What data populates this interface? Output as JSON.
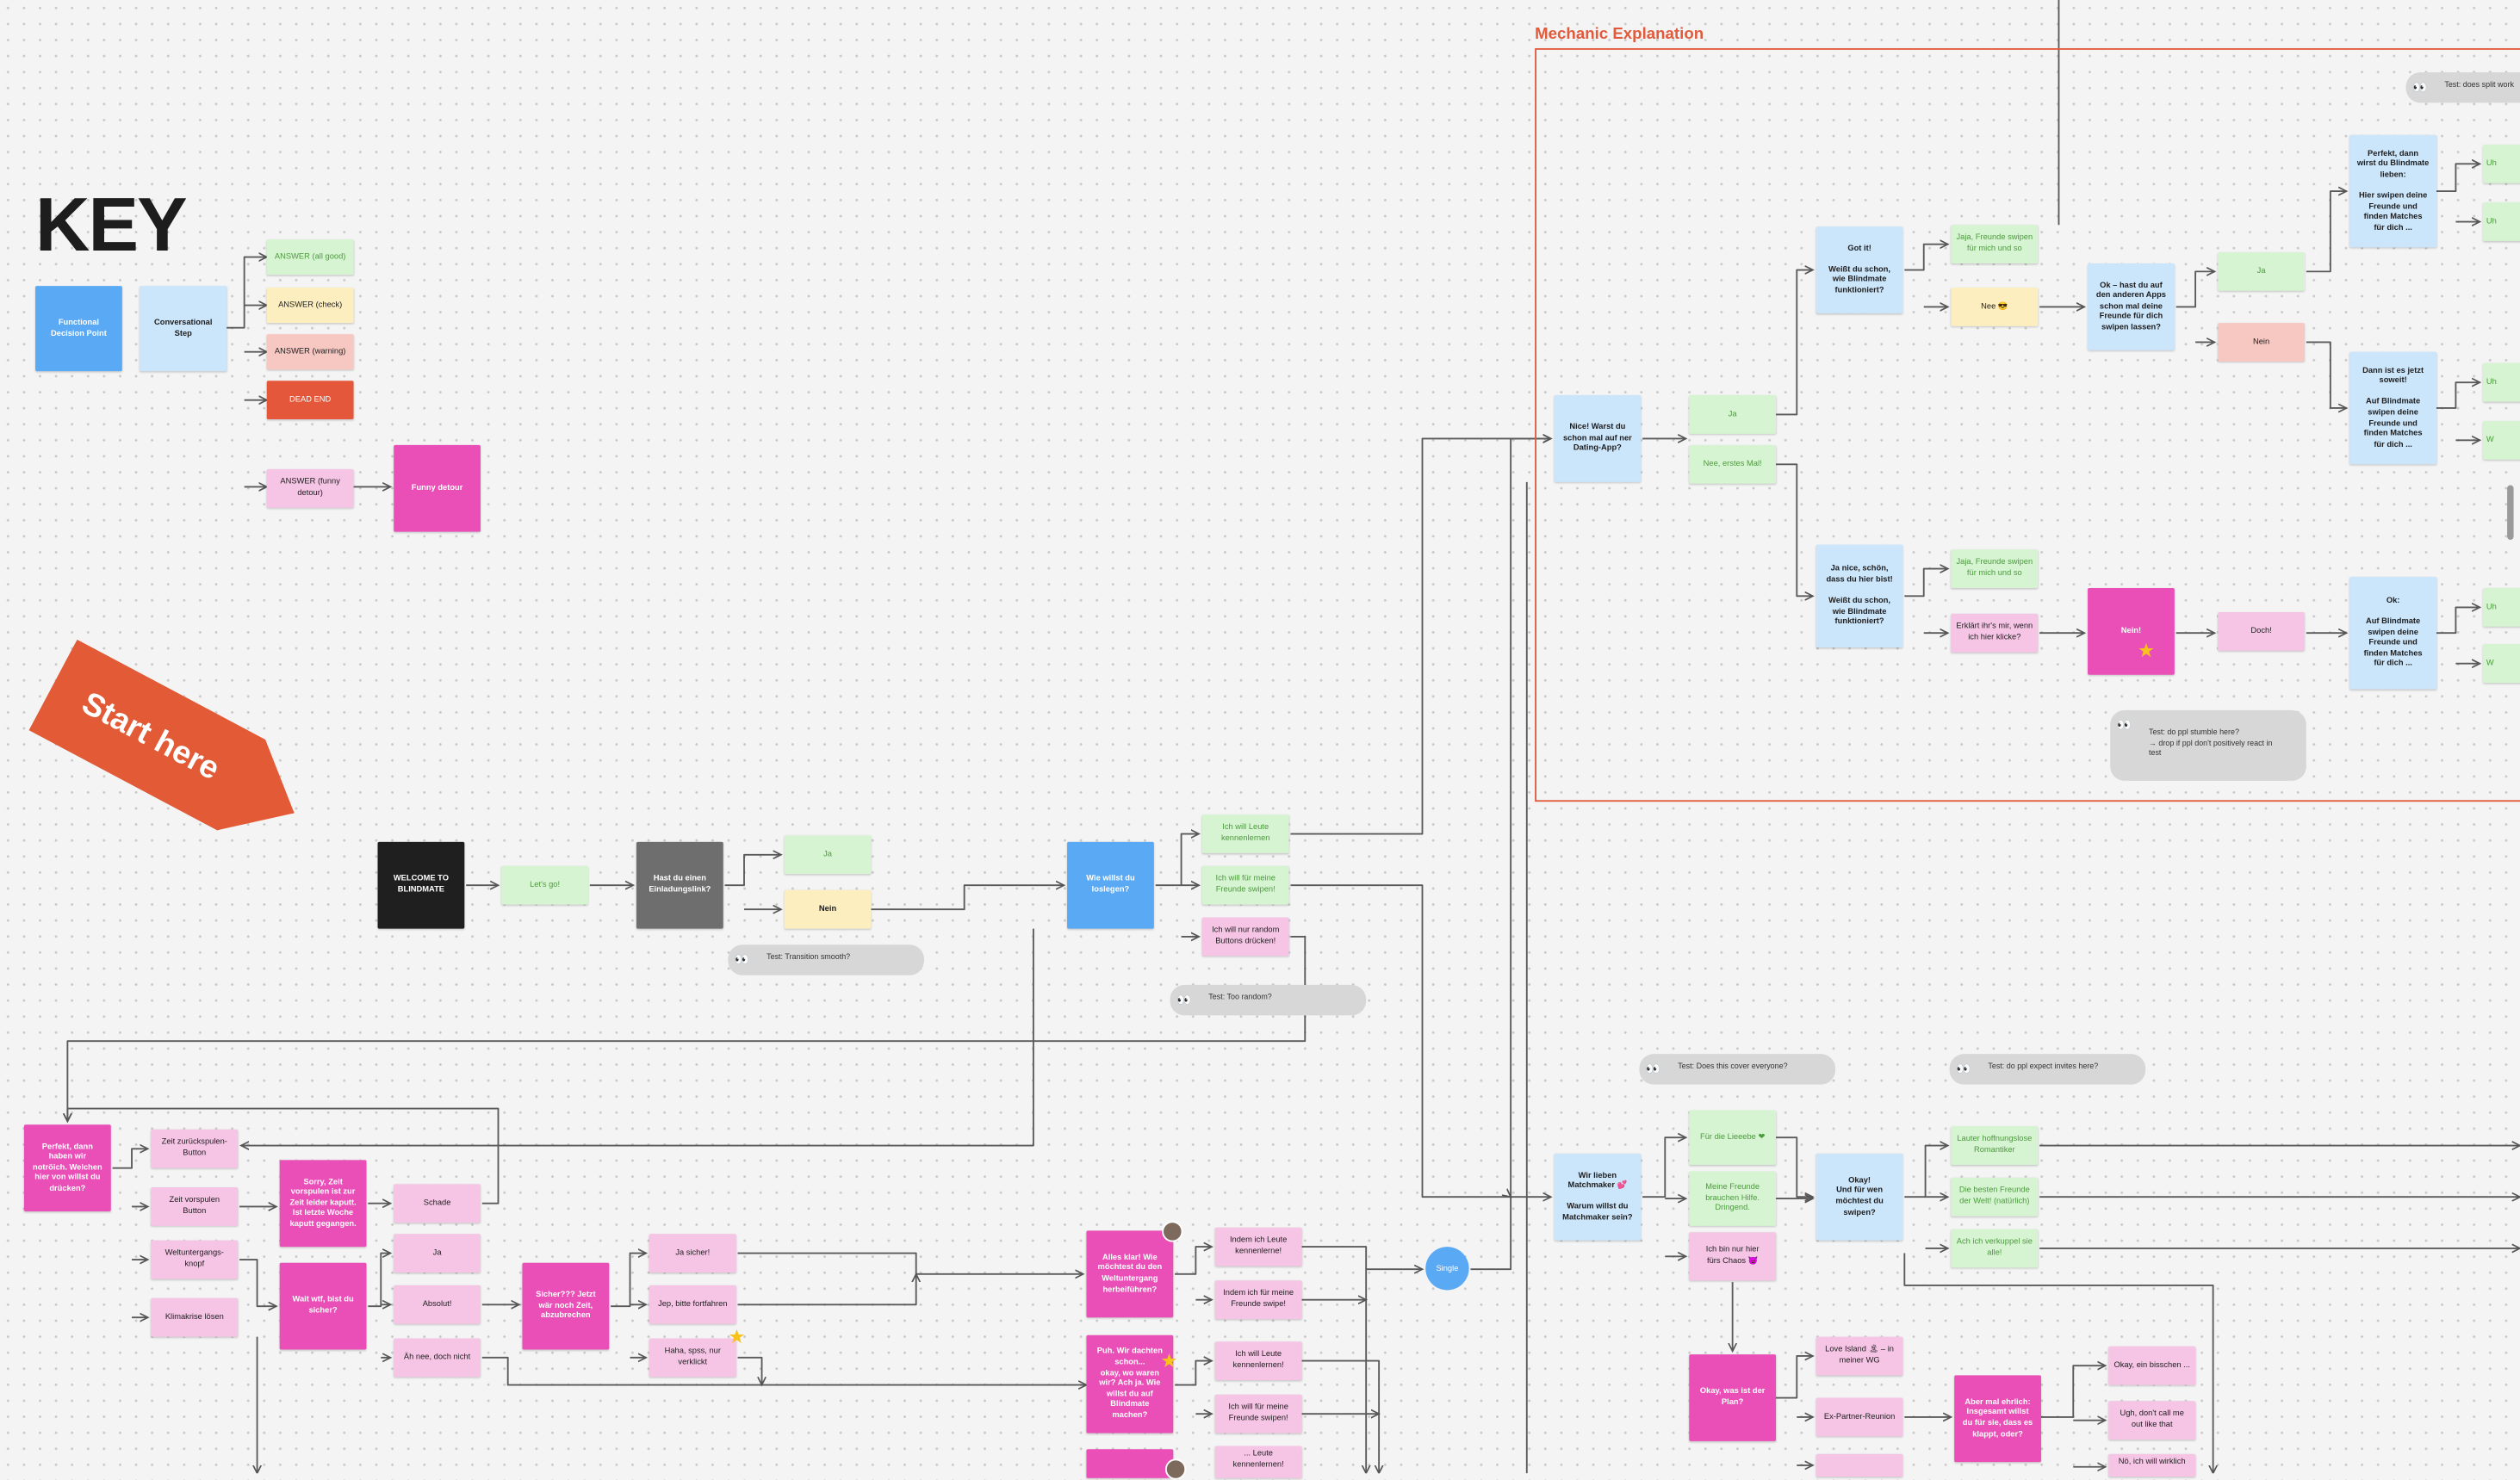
{
  "key": {
    "title": "KEY",
    "functional_decision_point": "Functional\nDecision Point",
    "conversational_step": "Conversational\nStep",
    "answer_good": "ANSWER (all good)",
    "answer_check": "ANSWER (check)",
    "answer_warning": "ANSWER (warning)",
    "dead_end": "DEAD END",
    "answer_funny": "ANSWER (funny\ndetour)",
    "funny_detour": "Funny detour"
  },
  "start_here": "Start here",
  "frame_title": "Mechanic Explanation",
  "flow": {
    "welcome": "WELCOME TO\nBLINDMATE",
    "lets_go": "Let's go!",
    "invite_q": "Hast du einen\nEinladungslink?",
    "ja": "Ja",
    "nein": "Nein",
    "how_start": "Wie willst du\nloslegen?",
    "meet_people": "Ich will Leute\nkennenlernen",
    "swipe_friends": "Ich will für meine\nFreunde swipen!",
    "random_buttons": "Ich will nur random\nButtons drücken!",
    "note_transition": "Test: Transition smooth?",
    "note_random": "Test: Too random?",
    "note_cover": "Test: Does this cover everyone?",
    "note_invites": "Test: do ppl expect invites here?",
    "note_split": "Test: does split work",
    "note_stumble": "Test: do ppl stumble here?\n→ drop if ppl don't positively react in\ntest"
  },
  "mechanic": {
    "used_dating": "Nice! Warst du\nschon mal auf ner\nDating-App?",
    "ja": "Ja",
    "nee_first": "Nee, erstes Mal!",
    "got_it": "Got it!\n\nWeißt du schon,\nwie Blindmate\nfunktioniert?",
    "ja_nice": "Ja nice, schön,\ndass du hier bist!\n\nWeißt du schon,\nwie Blindmate\nfunktioniert?",
    "jaja_1": "Jaja, Freunde swipen\nfür mich und so",
    "nee_emoji": "Nee 😎",
    "jaja_2": "Jaja, Freunde swipen\nfür mich und so",
    "explain": "Erklärt ihr's mir, wenn\nich hier klicke?",
    "ok_apps": "Ok – hast du auf\nden anderen Apps\nschon mal deine\nFreunde für dich\nswipen lassen?",
    "ja2": "Ja",
    "nein2": "Nein",
    "nein_big": "Nein!",
    "doch": "Doch!",
    "perfekt": "Perfekt, dann\nwirst du Blindmate\nlieben:\n\nHier swipen deine\nFreunde und\nfinden Matches\nfür dich ...",
    "dann_ist": "Dann ist es jetzt\nsoweit!\n\nAuf Blindmate\nswipen deine\nFreunde und\nfinden Matches\nfür dich ...",
    "ok_auf": "Ok:\n\nAuf Blindmate\nswipen deine\nFreunde und\nfinden Matches\nfür dich ...",
    "cut_uh": "Uh",
    "cut_w": "W"
  },
  "matchmaker": {
    "wir_lieben": "Wir lieben\nMatchmaker 💕\n\nWarum willst du\nMatchmaker sein?",
    "fuer_liebe": "Für die Lieeebe ❤",
    "friends_help": "Meine Freunde\nbrauchen Hilfe.\nDringend.",
    "chaos": "Ich bin nur hier\nfürs Chaos 😈",
    "okay_fuer_wen": "Okay!\nUnd für wen\nmöchtest du\nswipen?",
    "romantiker": "Lauter hoffnungslose\nRomantiker",
    "besten_freunde": "Die besten Freunde\nder Welt! (natürlich)",
    "verkuppel": "Ach ich verkuppel sie\nalle!",
    "plan": "Okay, was ist der\nPlan?",
    "love_island": "Love Island 🏝 – in\nmeiner WG",
    "ex_partner": "Ex-Partner-Reunion",
    "aber_ehrlich": "Aber mal ehrlich:\nInsgesamt willst\ndu für sie, dass es\nklappt, oder?",
    "okay_bisschen": "Okay, ein bisschen ...",
    "ugh": "Ugh, don't call me\nout like that",
    "noe": "Nö, ich will wirklich"
  },
  "detour": {
    "perfekt_random": "Perfekt, dann\nhaben wir\nnotröich. Welchen\nhier von willst du\ndrücken?",
    "zurueckspulen": "Zeit zurückspulen-\nButton",
    "vorspulen": "Zeit vorspulen\nButton",
    "weltuntergang": "Weltuntergangs-\nknopf",
    "klimakrise": "Klimakrise lösen",
    "sorry": "Sorry, Zeit\nvorspulen ist zur\nZeit leider kaputt.\nIst letzte Woche\nkaputt gegangen.",
    "schade": "Schade",
    "ja": "Ja",
    "absolut": "Absolut!",
    "doch_nicht": "Äh nee, doch nicht",
    "wait": "Wait wtf, bist du\nsicher?",
    "sicher_abbrechen": "Sicher??? Jetzt\nwär noch Zeit,\nabzubrechen",
    "ja_sicher": "Ja sicher!",
    "jep": "Jep, bitte fortfahren",
    "haha": "Haha, spss, nur\nverklickt",
    "alles_klar": "Alles klar! Wie\nmöchtest du den\nWeltuntergang\nherbeiführen?",
    "puh": "Puh. Wir dachten\nschon...\nokay, wo waren\nwir? Ach ja. Wie\nwillst du auf\nBlindmate\nmachen?",
    "indem_leute": "Indem ich Leute\nkennenlerne!",
    "indem_freunde": "Indem ich für meine\nFreunde swipe!",
    "ich_leute": "Ich will Leute\nkennenlernen!",
    "ich_freunde": "Ich will für meine\nFreunde swipen!",
    "leute_cut": "... Leute\nkennenlernen!",
    "single": "Single"
  },
  "colors": {
    "functional": "#5aa9f5",
    "conversational": "#cbe5fb",
    "good": "#d6f4d2",
    "check": "#fdeec0",
    "warning": "#f7c8c2",
    "dead_end": "#e4573a",
    "funny_answer": "#f6c5e6",
    "funny_detour": "#ea4fb7",
    "frame": "#e15a3c"
  }
}
